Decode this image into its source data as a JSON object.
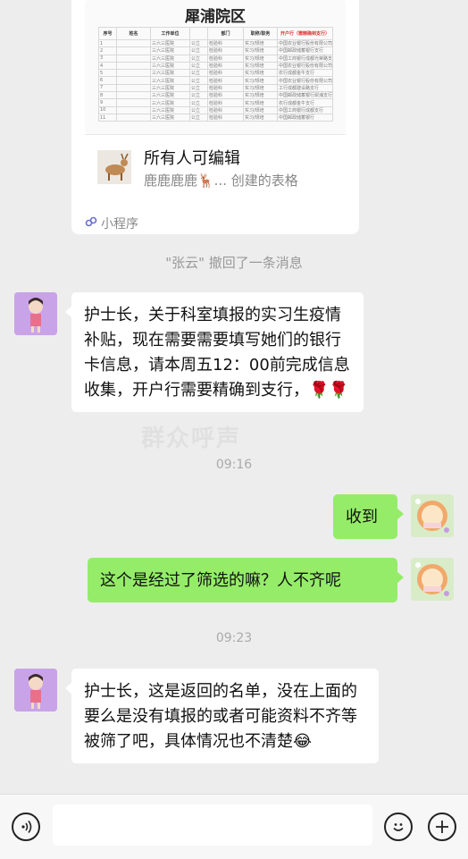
{
  "card": {
    "sheet_title": "犀浦院区",
    "columns": [
      "序号",
      "姓名",
      "工作单位",
      "",
      "部门",
      "职称/职务",
      "开户行（需精确到支行）"
    ],
    "rows": [
      [
        "1",
        "",
        "三六三医院",
        "公立",
        "检验科",
        "实习/规培",
        "中国农业银行股份有限公司"
      ],
      [
        "2",
        "",
        "三六三医院",
        "公立",
        "检验科",
        "实习/规培",
        "中国邮政储蓄银行支行"
      ],
      [
        "3",
        "",
        "三六三医院",
        "公立",
        "检验科",
        "实习/规培",
        "中国工商银行成都光荣路支行"
      ],
      [
        "4",
        "",
        "三六三医院",
        "公立",
        "检验科",
        "实习/规培",
        "中国农业银行股份有限公司"
      ],
      [
        "5",
        "",
        "三六三医院",
        "公立",
        "检验科",
        "实习/规培",
        "农行成都金牛支行"
      ],
      [
        "6",
        "",
        "三六三医院",
        "公立",
        "检验科",
        "实习/规培",
        "中国农业银行股份有限公司"
      ],
      [
        "7",
        "",
        "三六三医院",
        "公立",
        "检验科",
        "实习/规培",
        "工行成都建设路支行"
      ],
      [
        "8",
        "",
        "三六三医院",
        "公立",
        "检验科",
        "实习/规培",
        "中国邮政储蓄银行犀浦支行"
      ],
      [
        "9",
        "",
        "三六三医院",
        "公立",
        "检验科",
        "实习/规培",
        "农行成都金牛支行"
      ],
      [
        "10",
        "",
        "三六三医院",
        "公立",
        "检验科",
        "实习/规培",
        "中国工商银行成都支行"
      ],
      [
        "11",
        "",
        "三六三医院",
        "公立",
        "检验科",
        "实习/规培",
        "中国邮政储蓄银行"
      ]
    ],
    "doc_title": "所有人可编辑",
    "doc_sub": "鹿鹿鹿鹿🦌... 创建的表格",
    "mini_program": "小程序"
  },
  "recall_notice": "\"张云\" 撤回了一条消息",
  "messages": {
    "m1": "护士长，关于科室填报的实习生疫情补贴，现在需要需要填写她们的银行卡信息，请本周五12：00前完成信息收集，开户行需要精确到支行，🌹🌹",
    "t1": "09:16",
    "m2": "收到",
    "m3": "这个是经过了筛选的嘛？人不齐呢",
    "t2": "09:23",
    "m4": "护士长，这是返回的名单，没在上面的要么是没有填报的或者可能资料不齐等被筛了吧，具体情况也不清楚😂"
  },
  "watermark": "群众呼声",
  "icons": {
    "voice": "voice-icon",
    "emoji": "emoji-icon",
    "plus": "plus-icon"
  },
  "colors": {
    "background": "#ededed",
    "bubble_self": "#95ec69",
    "bubble_other": "#ffffff"
  }
}
